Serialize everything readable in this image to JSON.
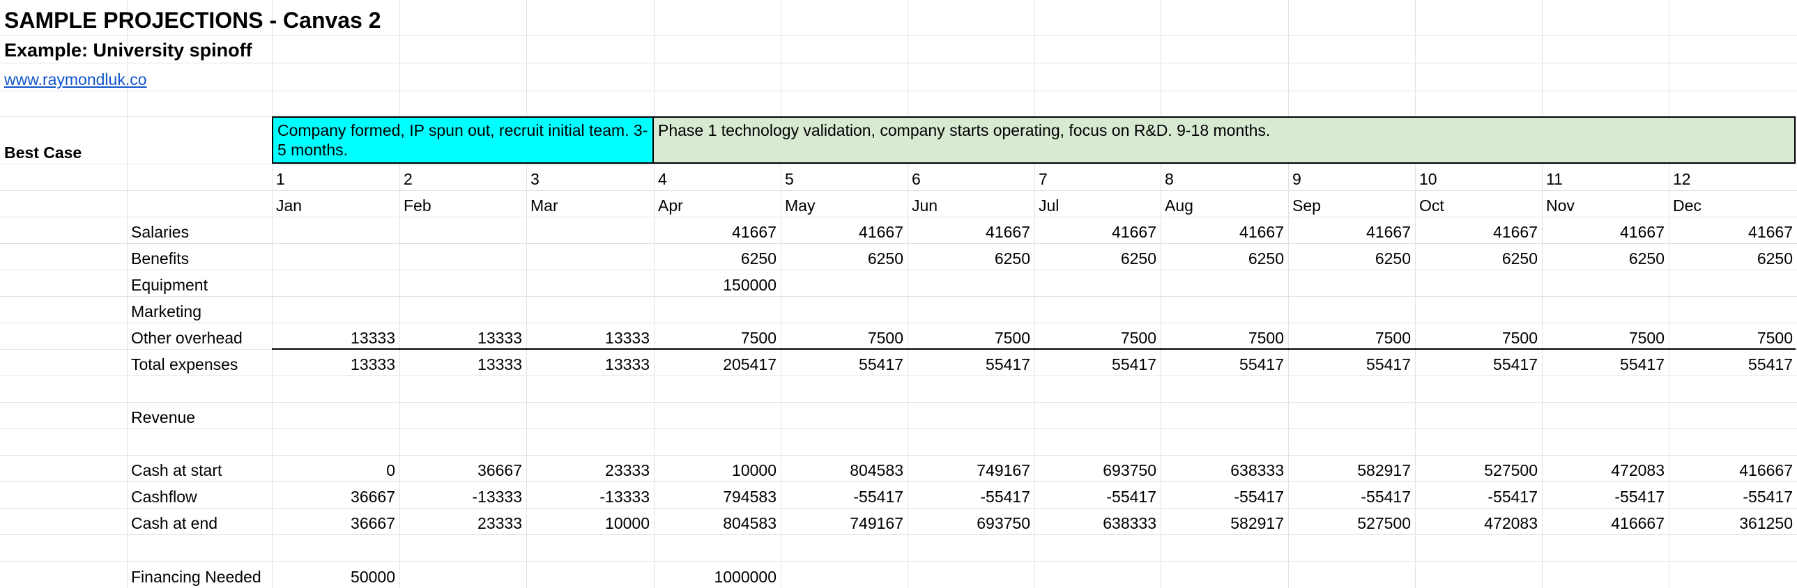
{
  "sheet": {
    "title": "SAMPLE PROJECTIONS - Canvas 2",
    "subtitle": "Example: University spinoff",
    "link": "www.raymondluk.co",
    "scenario": "Best Case"
  },
  "phases": [
    {
      "text": "Company formed, IP spun out, recruit initial team. 3-5 months.",
      "color": "#00ffff"
    },
    {
      "text": "Phase 1 technology validation, company starts operating, focus on R&D. 9-18 months.",
      "color": "#d9ead3"
    }
  ],
  "month_numbers": [
    "1",
    "2",
    "3",
    "4",
    "5",
    "6",
    "7",
    "8",
    "9",
    "10",
    "11",
    "12"
  ],
  "months": [
    "Jan",
    "Feb",
    "Mar",
    "Apr",
    "May",
    "Jun",
    "Jul",
    "Aug",
    "Sep",
    "Oct",
    "Nov",
    "Dec"
  ],
  "rows": [
    {
      "label": "Salaries",
      "values": [
        "",
        "",
        "",
        "41667",
        "41667",
        "41667",
        "41667",
        "41667",
        "41667",
        "41667",
        "41667",
        "41667"
      ]
    },
    {
      "label": "Benefits",
      "values": [
        "",
        "",
        "",
        "6250",
        "6250",
        "6250",
        "6250",
        "6250",
        "6250",
        "6250",
        "6250",
        "6250"
      ]
    },
    {
      "label": "Equipment",
      "values": [
        "",
        "",
        "",
        "150000",
        "",
        "",
        "",
        "",
        "",
        "",
        "",
        ""
      ]
    },
    {
      "label": "Marketing",
      "values": [
        "",
        "",
        "",
        "",
        "",
        "",
        "",
        "",
        "",
        "",
        "",
        ""
      ]
    },
    {
      "label": "Other overhead",
      "values": [
        "13333",
        "13333",
        "13333",
        "7500",
        "7500",
        "7500",
        "7500",
        "7500",
        "7500",
        "7500",
        "7500",
        "7500"
      ]
    },
    {
      "label": "Total expenses",
      "values": [
        "13333",
        "13333",
        "13333",
        "205417",
        "55417",
        "55417",
        "55417",
        "55417",
        "55417",
        "55417",
        "55417",
        "55417"
      ]
    },
    {
      "label": "",
      "values": [
        "",
        "",
        "",
        "",
        "",
        "",
        "",
        "",
        "",
        "",
        "",
        ""
      ]
    },
    {
      "label": "Revenue",
      "values": [
        "",
        "",
        "",
        "",
        "",
        "",
        "",
        "",
        "",
        "",
        "",
        ""
      ]
    },
    {
      "label": "",
      "values": [
        "",
        "",
        "",
        "",
        "",
        "",
        "",
        "",
        "",
        "",
        "",
        ""
      ]
    },
    {
      "label": "Cash at start",
      "values": [
        "0",
        "36667",
        "23333",
        "10000",
        "804583",
        "749167",
        "693750",
        "638333",
        "582917",
        "527500",
        "472083",
        "416667"
      ]
    },
    {
      "label": "Cashflow",
      "values": [
        "36667",
        "-13333",
        "-13333",
        "794583",
        "-55417",
        "-55417",
        "-55417",
        "-55417",
        "-55417",
        "-55417",
        "-55417",
        "-55417"
      ]
    },
    {
      "label": "Cash at end",
      "values": [
        "36667",
        "23333",
        "10000",
        "804583",
        "749167",
        "693750",
        "638333",
        "582917",
        "527500",
        "472083",
        "416667",
        "361250"
      ]
    },
    {
      "label": "",
      "values": [
        "",
        "",
        "",
        "",
        "",
        "",
        "",
        "",
        "",
        "",
        "",
        ""
      ]
    },
    {
      "label": "Financing Needed",
      "values": [
        "50000",
        "",
        "",
        "1000000",
        "",
        "",
        "",
        "",
        "",
        "",
        "",
        ""
      ]
    }
  ]
}
